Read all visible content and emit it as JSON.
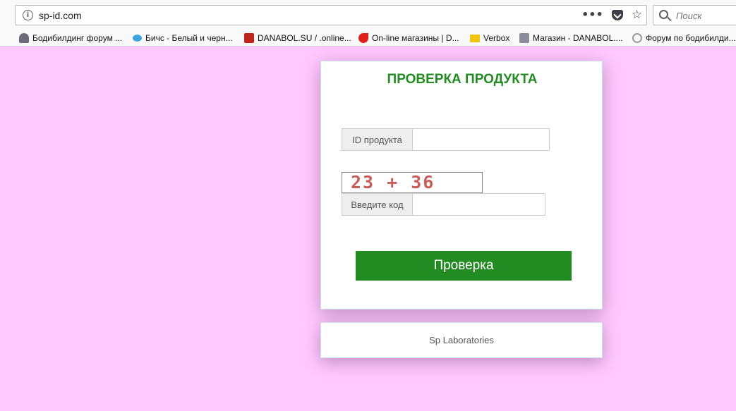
{
  "browser": {
    "url": "sp-id.com",
    "search_placeholder": "Поиск",
    "bookmarks": [
      {
        "label": "Бодибилдинг форум ...",
        "icon": "gym-icon"
      },
      {
        "label": "Бичс - Белый и черн...",
        "icon": "bird-icon"
      },
      {
        "label": "DANABOL.SU / .online...",
        "icon": "danabol-400-icon"
      },
      {
        "label": "On-line магазины | D...",
        "icon": "store-logo-icon"
      },
      {
        "label": "Verbox",
        "icon": "envelope-icon"
      },
      {
        "label": "Магазин - DANABOL....",
        "icon": "shop-icon"
      },
      {
        "label": "Форум по бодибилди...",
        "icon": "forum-icon"
      }
    ]
  },
  "form": {
    "title": "ПРОВЕРКА ПРОДУКТА",
    "product_id_label": "ID продукта",
    "product_id_value": "",
    "captcha_text": "23 + 36",
    "code_label": "Введите код",
    "code_value": "",
    "submit_label": "Проверка"
  },
  "footer": {
    "text": "Sp Laboratories"
  },
  "colors": {
    "page_background": "#ffc8ff",
    "accent_green": "#228b22",
    "captcha_text": "#c65f5a"
  }
}
